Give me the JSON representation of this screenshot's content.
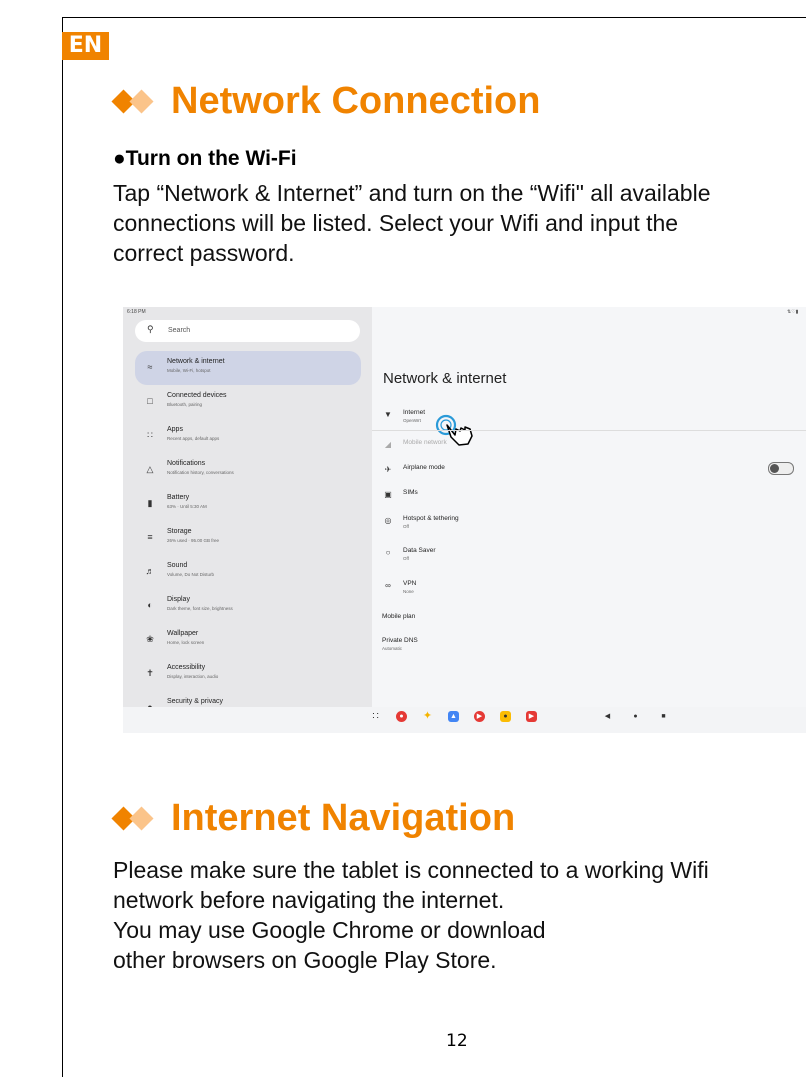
{
  "lang": "EN",
  "section1": {
    "title": "Network Connection",
    "subheading": "●Turn on the Wi-Fi",
    "lines": [
      "Tap “Network & Internet” and turn on the “Wifi\" all available",
      "connections will be listed. Select your Wifi and input the",
      "correct password."
    ]
  },
  "screenshot": {
    "status_time": "6:18 PM",
    "search_placeholder": "Search",
    "sidebar": [
      {
        "title": "Network & internet",
        "sub": "Mobile, Wi-Fi, hotspot"
      },
      {
        "title": "Connected devices",
        "sub": "Bluetooth, pairing"
      },
      {
        "title": "Apps",
        "sub": "Recent apps, default apps"
      },
      {
        "title": "Notifications",
        "sub": "Notification history, conversations"
      },
      {
        "title": "Battery",
        "sub": "63% · Until 5:30 AM"
      },
      {
        "title": "Storage",
        "sub": "26% used · 95.00 GB free"
      },
      {
        "title": "Sound",
        "sub": "Volume, Do Not Disturb"
      },
      {
        "title": "Display",
        "sub": "Dark theme, font size, brightness"
      },
      {
        "title": "Wallpaper",
        "sub": "Home, lock screen"
      },
      {
        "title": "Accessibility",
        "sub": "Display, interaction, audio"
      },
      {
        "title": "Security & privacy",
        "sub": ""
      }
    ],
    "panel_title": "Network & internet",
    "items": [
      {
        "title": "Internet",
        "sub": "OpenWrt"
      },
      {
        "title": "Mobile network",
        "sub": ""
      },
      {
        "title": "Airplane mode",
        "sub": ""
      },
      {
        "title": "SIMs",
        "sub": ""
      },
      {
        "title": "Hotspot & tethering",
        "sub": "Off"
      },
      {
        "title": "Data Saver",
        "sub": "Off"
      },
      {
        "title": "VPN",
        "sub": "None"
      }
    ],
    "mobile_plan": "Mobile plan",
    "private_dns": {
      "title": "Private DNS",
      "sub": "Automatic"
    }
  },
  "section2": {
    "title": "Internet Navigation",
    "lines": [
      "Please make sure the tablet is connected to a working Wifi",
      "network before navigating the internet.",
      "You may use Google Chrome  or download",
      "other browsers  on Google Play Store."
    ]
  },
  "page_number": "12"
}
